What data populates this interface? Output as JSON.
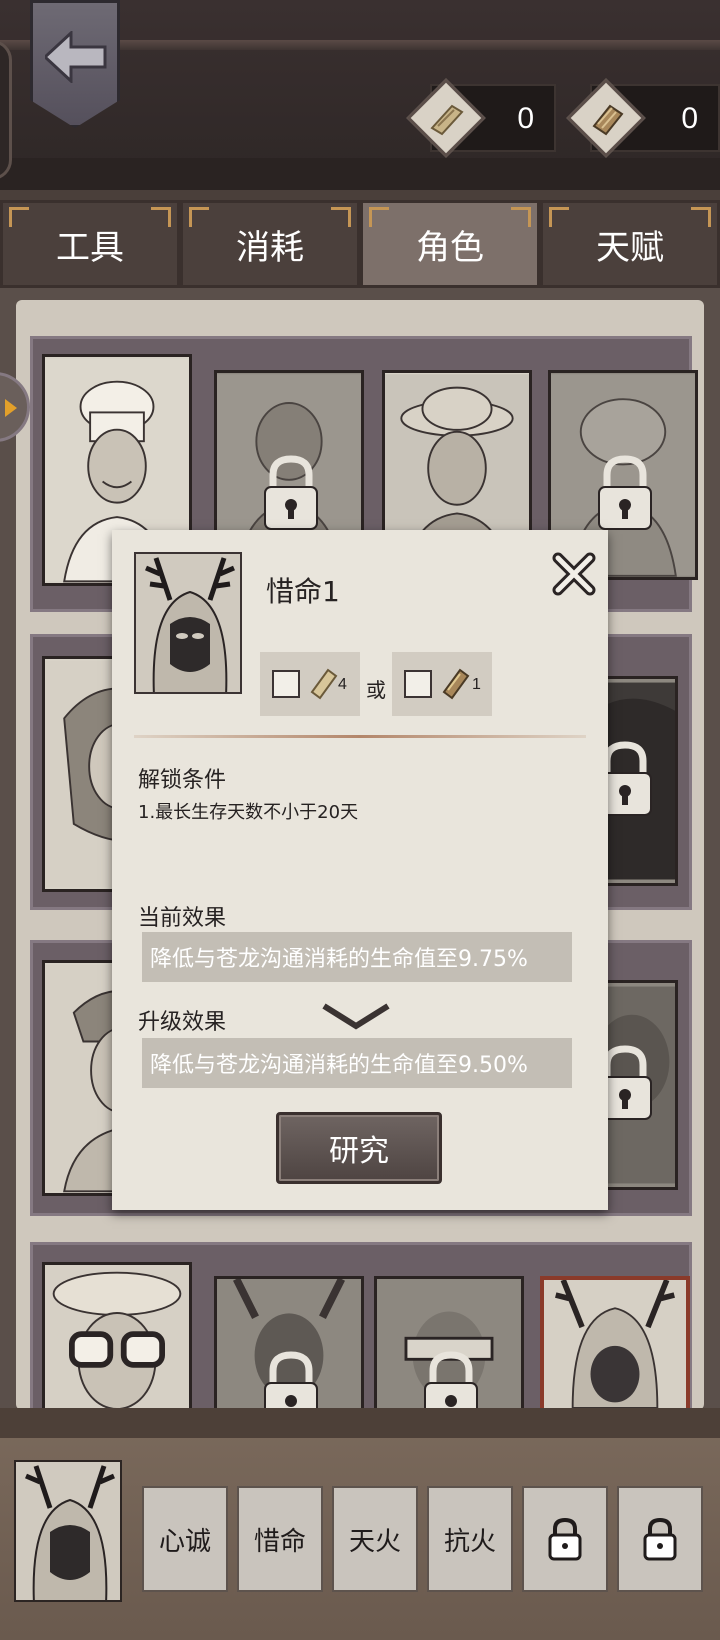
{
  "header": {
    "currency": [
      {
        "icon": "scroll-icon",
        "count": "0"
      },
      {
        "icon": "book-icon",
        "count": "0"
      }
    ]
  },
  "tabs": [
    {
      "label": "工具",
      "active": false
    },
    {
      "label": "消耗",
      "active": false
    },
    {
      "label": "角色",
      "active": true
    },
    {
      "label": "天赋",
      "active": false
    }
  ],
  "modal": {
    "title": "惜命1",
    "cost_a_qty": "4",
    "cost_or": "或",
    "cost_b_qty": "1",
    "unlock_title": "解锁条件",
    "unlock_condition": "1.最长生存天数不小于20天",
    "current_title": "当前效果",
    "current_effect": "降低与苍龙沟通消耗的生命值至9.75%",
    "upgrade_title": "升级效果",
    "upgrade_effect": "降低与苍龙沟通消耗的生命值至9.50%",
    "research_label": "研究"
  },
  "skills": [
    {
      "label": "心诚",
      "locked": false
    },
    {
      "label": "惜命",
      "locked": false
    },
    {
      "label": "天火",
      "locked": false
    },
    {
      "label": "抗火",
      "locked": false
    },
    {
      "label": "",
      "locked": true
    },
    {
      "label": "",
      "locked": true
    }
  ],
  "colors": {
    "accent_gold": "#c59655",
    "selected_border": "#8a3a2a",
    "parchment": "#e9e5dc"
  }
}
